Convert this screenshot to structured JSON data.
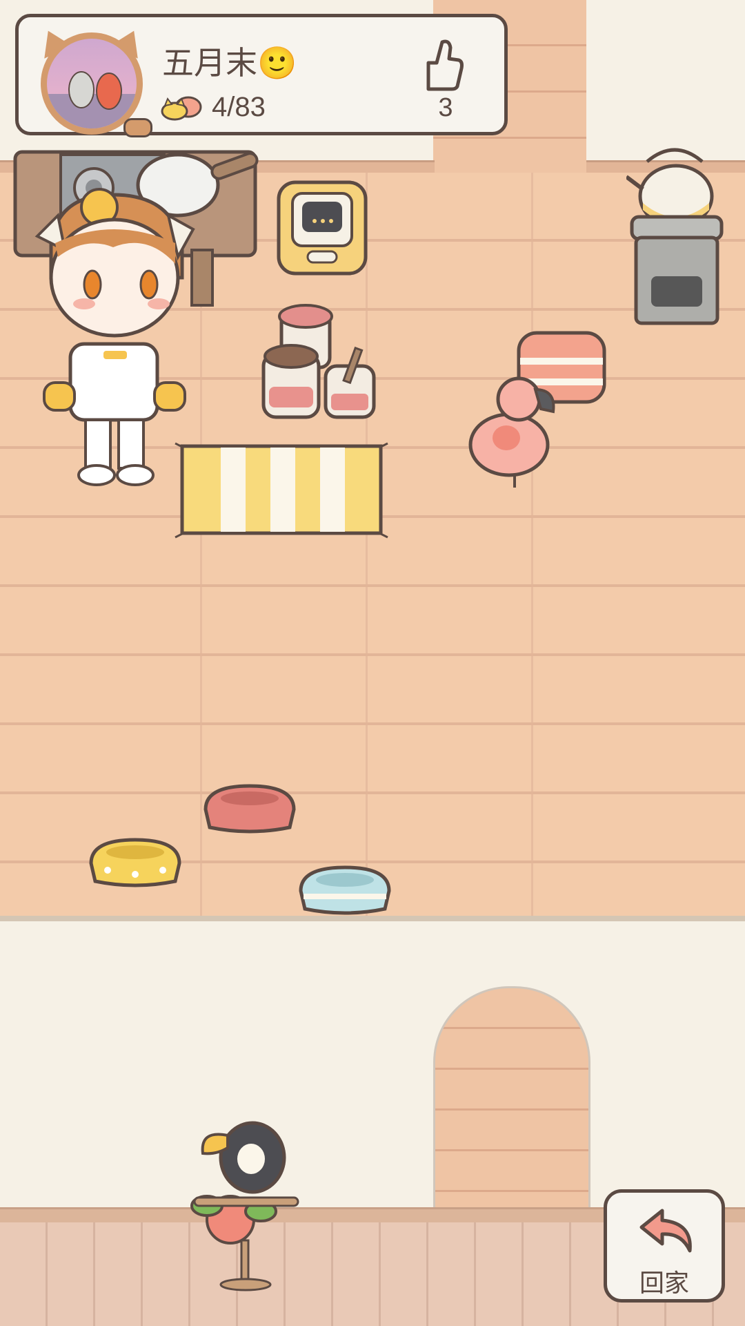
{
  "profile": {
    "name": "五月末🙂",
    "score": "4/83",
    "likes": "3"
  },
  "home_button": {
    "label": "回家"
  },
  "icons": {
    "coin": "cat-coin-icon",
    "like": "thumbs-up-icon",
    "home": "return-arrow-icon"
  },
  "colors": {
    "outline": "#5b4a43",
    "card_bg": "#f7f4ee",
    "floor": "#f3cbaa",
    "avatar_ring": "#d49b6c",
    "home_arrow": "#f29a8c"
  }
}
